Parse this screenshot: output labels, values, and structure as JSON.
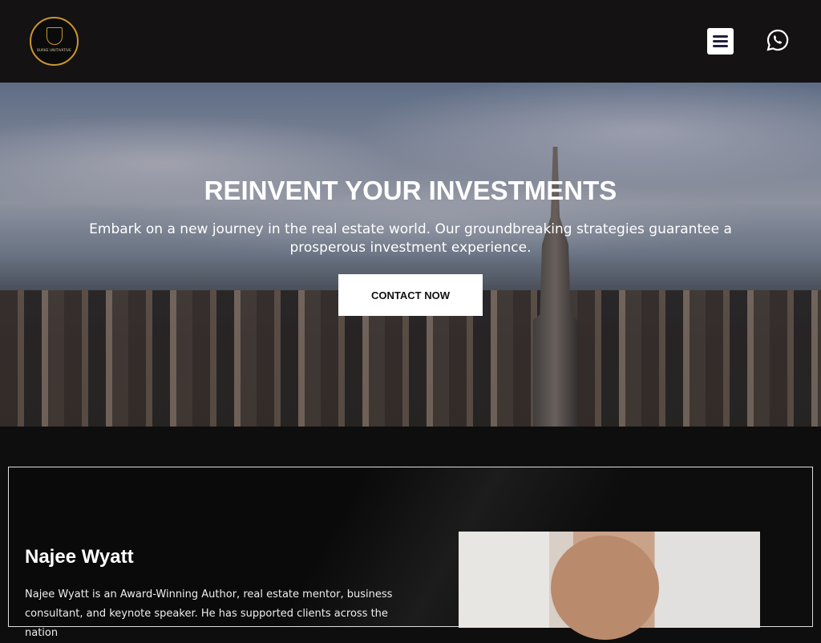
{
  "header": {
    "logo_text": "BURKE UNITIVATIVE",
    "menu_icon": "hamburger-icon",
    "whatsapp_icon": "whatsapp-icon"
  },
  "hero": {
    "title": "REINVENT YOUR INVESTMENTS",
    "subtitle": "Embark on a new journey in the real estate world. Our groundbreaking strategies guarantee a prosperous investment experience.",
    "cta_label": "CONTACT NOW"
  },
  "about": {
    "name": "Najee Wyatt",
    "bio": "Najee Wyatt is an Award-Winning Author, real estate mentor, business consultant, and keynote speaker. He has supported clients across the nation"
  }
}
